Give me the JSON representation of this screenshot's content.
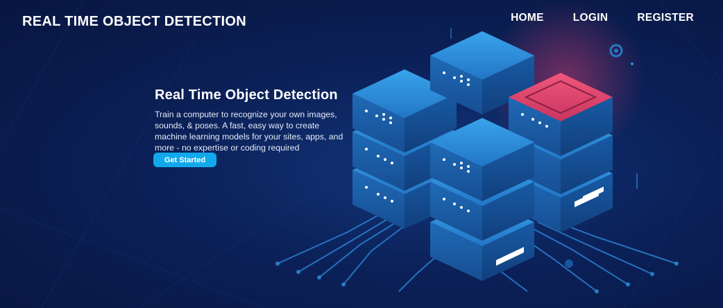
{
  "brand": {
    "title": "REAL TIME OBJECT DETECTION"
  },
  "nav": {
    "home": "HOME",
    "login": "LOGIN",
    "register": "REGISTER"
  },
  "hero": {
    "heading": "Real Time Object Detection",
    "description": "Train a computer to recognize your own images, sounds, & poses. A fast, easy way to create machine learning models for your sites, apps, and more - no expertise or coding required",
    "cta_label": "Get Started"
  },
  "colors": {
    "background": "#0b2057",
    "accent": "#12a9ec",
    "server_blue": "#2a7fd0",
    "server_red": "#e0406a"
  },
  "illustration": {
    "name": "isometric-server-stack-illustration"
  }
}
